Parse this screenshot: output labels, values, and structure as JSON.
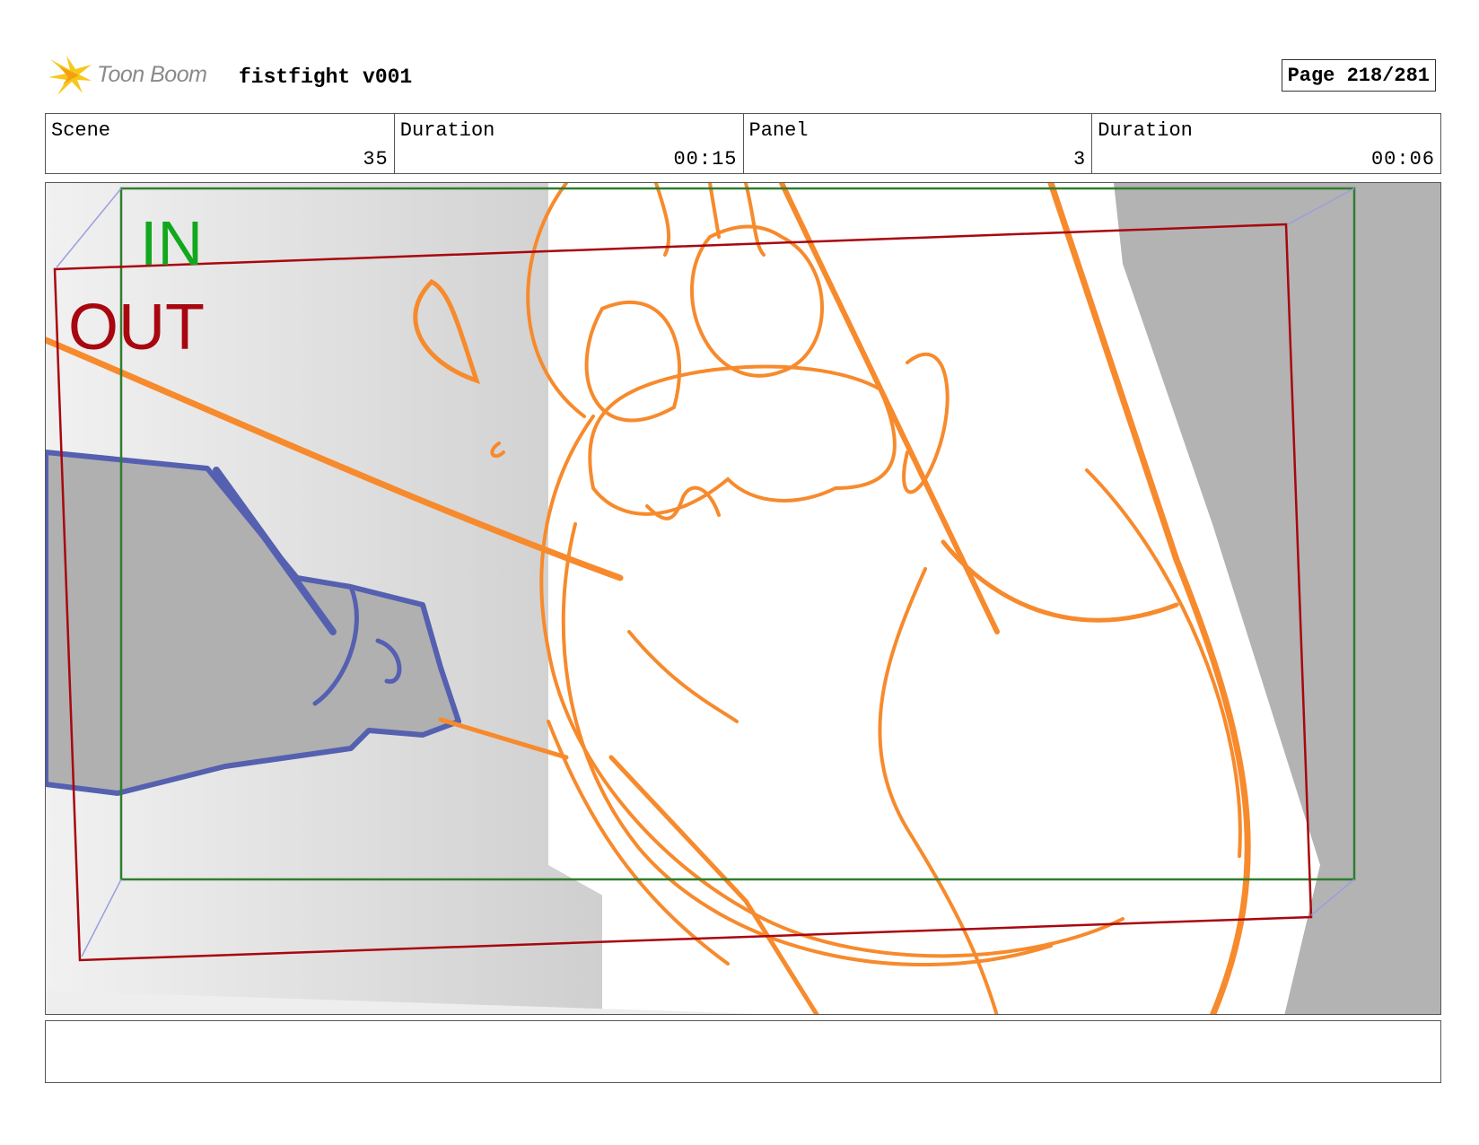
{
  "header": {
    "logo_text": "Toon Boom",
    "title": "fistfight v001",
    "page_label": "Page 218/281"
  },
  "info": {
    "scene_label": "Scene",
    "scene_value": "35",
    "scene_duration_label": "Duration",
    "scene_duration_value": "00:15",
    "panel_label": "Panel",
    "panel_value": "3",
    "panel_duration_label": "Duration",
    "panel_duration_value": "00:06"
  },
  "panel": {
    "in_label": "IN",
    "out_label": "OUT"
  },
  "colors": {
    "sketch": "#f78a2c",
    "fist_outline": "#5560b0",
    "fist_fill": "#b0b0b0",
    "in_frame": "#2f7d2f",
    "out_frame": "#a8070f",
    "in_text": "#12a81e",
    "out_text": "#a8070f"
  },
  "icons": {
    "logo": "toon-boom-star-icon"
  },
  "notes": {
    "text": ""
  }
}
